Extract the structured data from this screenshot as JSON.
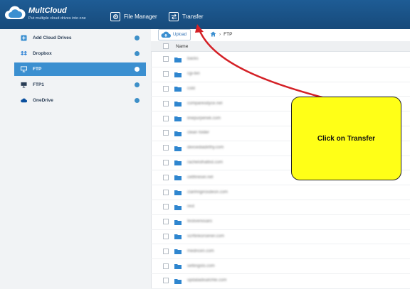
{
  "header": {
    "brand": "MultCloud",
    "tagline": "Put multiple cloud drives into one",
    "nav": [
      {
        "label": "File Manager",
        "icon": "gear-icon"
      },
      {
        "label": "Transfer",
        "icon": "transfer-icon"
      }
    ]
  },
  "sidebar": {
    "items": [
      {
        "label": "Add Cloud Drives",
        "icon": "add-cloud-icon",
        "active": false
      },
      {
        "label": "Dropbox",
        "icon": "dropbox-icon",
        "active": false
      },
      {
        "label": "FTP",
        "icon": "ftp-icon",
        "active": true
      },
      {
        "label": "FTP1",
        "icon": "ftp-icon",
        "active": false
      },
      {
        "label": "OneDrive",
        "icon": "onedrive-icon",
        "active": false
      }
    ]
  },
  "toolbar": {
    "upload_label": "Upload",
    "breadcrumb_current": "FTP"
  },
  "list": {
    "column_name": "Name",
    "rows": [
      "backs",
      "cgi-bin",
      "cstd",
      "compareodyce.net",
      "linepurperwk.com",
      "clean folder",
      "dexsediadirthy.com",
      "rachelsthattist.com",
      "cellfinesel.net",
      "clanhngirosdeon.com",
      "rest",
      "festivenisiaro",
      "scrftinkorsener.com",
      "medncen.com",
      "settingsto.com",
      "updatadisafchte.com"
    ]
  },
  "callout": {
    "text": "Click on Transfer"
  },
  "colors": {
    "header": "#1e5c95",
    "accent": "#3b8fd0",
    "callout_bg": "#ffff17",
    "arrow": "#d42026"
  }
}
